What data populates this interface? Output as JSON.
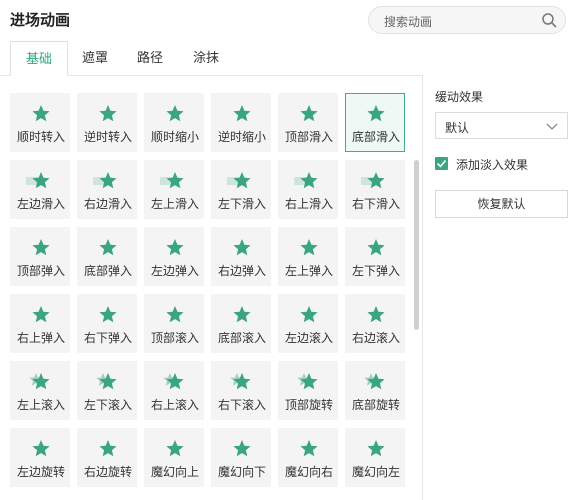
{
  "header": {
    "title": "进场动画",
    "search_placeholder": "搜索动画"
  },
  "tabs": [
    {
      "label": "基础",
      "active": true
    },
    {
      "label": "遮罩",
      "active": false
    },
    {
      "label": "路径",
      "active": false
    },
    {
      "label": "涂抹",
      "active": false
    }
  ],
  "animations": [
    {
      "label": "顺时转入",
      "icon": "star-rotate-cw-icon",
      "selected": false
    },
    {
      "label": "逆时转入",
      "icon": "star-rotate-ccw-icon",
      "selected": false
    },
    {
      "label": "顺时缩小",
      "icon": "star-shrink-cw-icon",
      "selected": false
    },
    {
      "label": "逆时缩小",
      "icon": "star-shrink-ccw-icon",
      "selected": false
    },
    {
      "label": "顶部滑入",
      "icon": "star-slide-top-icon",
      "selected": false
    },
    {
      "label": "底部滑入",
      "icon": "star-slide-bottom-icon",
      "selected": true
    },
    {
      "label": "左边滑入",
      "icon": "star-slide-left-icon",
      "selected": false
    },
    {
      "label": "右边滑入",
      "icon": "star-slide-right-icon",
      "selected": false
    },
    {
      "label": "左上滑入",
      "icon": "star-slide-top-left-icon",
      "selected": false
    },
    {
      "label": "左下滑入",
      "icon": "star-slide-bottom-left-icon",
      "selected": false
    },
    {
      "label": "右上滑入",
      "icon": "star-slide-top-right-icon",
      "selected": false
    },
    {
      "label": "右下滑入",
      "icon": "star-slide-bottom-right-icon",
      "selected": false
    },
    {
      "label": "顶部弹入",
      "icon": "star-bounce-top-icon",
      "selected": false
    },
    {
      "label": "底部弹入",
      "icon": "star-bounce-bottom-icon",
      "selected": false
    },
    {
      "label": "左边弹入",
      "icon": "star-bounce-left-icon",
      "selected": false
    },
    {
      "label": "右边弹入",
      "icon": "star-bounce-right-icon",
      "selected": false
    },
    {
      "label": "左上弹入",
      "icon": "star-bounce-top-left-icon",
      "selected": false
    },
    {
      "label": "左下弹入",
      "icon": "star-bounce-bottom-left-icon",
      "selected": false
    },
    {
      "label": "右上弹入",
      "icon": "star-bounce-top-right-icon",
      "selected": false
    },
    {
      "label": "右下弹入",
      "icon": "star-bounce-bottom-right-icon",
      "selected": false
    },
    {
      "label": "顶部滚入",
      "icon": "star-roll-top-icon",
      "selected": false
    },
    {
      "label": "底部滚入",
      "icon": "star-roll-bottom-icon",
      "selected": false
    },
    {
      "label": "左边滚入",
      "icon": "star-roll-left-icon",
      "selected": false
    },
    {
      "label": "右边滚入",
      "icon": "star-roll-right-icon",
      "selected": false
    },
    {
      "label": "左上滚入",
      "icon": "star-roll-top-left-icon",
      "selected": false
    },
    {
      "label": "左下滚入",
      "icon": "star-roll-bottom-left-icon",
      "selected": false
    },
    {
      "label": "右上滚入",
      "icon": "star-roll-top-right-icon",
      "selected": false
    },
    {
      "label": "右下滚入",
      "icon": "star-roll-bottom-right-icon",
      "selected": false
    },
    {
      "label": "顶部旋转",
      "icon": "star-spin-top-icon",
      "selected": false
    },
    {
      "label": "底部旋转",
      "icon": "star-spin-bottom-icon",
      "selected": false
    },
    {
      "label": "左边旋转",
      "icon": "star-spin-left-icon",
      "selected": false
    },
    {
      "label": "右边旋转",
      "icon": "star-spin-right-icon",
      "selected": false
    },
    {
      "label": "魔幻向上",
      "icon": "star-magic-up-icon",
      "selected": false
    },
    {
      "label": "魔幻向下",
      "icon": "star-magic-down-icon",
      "selected": false
    },
    {
      "label": "魔幻向右",
      "icon": "star-magic-right-icon",
      "selected": false
    },
    {
      "label": "魔幻向左",
      "icon": "star-magic-left-icon",
      "selected": false
    }
  ],
  "panel": {
    "easing_label": "缓动效果",
    "easing_value": "默认",
    "fade_label": "添加淡入效果",
    "fade_checked": true,
    "reset_label": "恢复默认"
  },
  "colors": {
    "accent": "#2fa87a",
    "star": "#3aa57f",
    "cell_bg": "#f4f4f4"
  }
}
